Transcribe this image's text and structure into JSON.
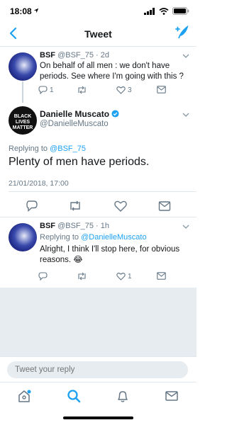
{
  "status_bar": {
    "time": "18:08"
  },
  "nav": {
    "title": "Tweet"
  },
  "tweet_parent": {
    "name": "BSF",
    "handle": "@BSF_75",
    "time": "· 2d",
    "text": "On behalf of all men : we don't have periods. See where I'm going with this ?",
    "reply_count": "1",
    "like_count": "3"
  },
  "tweet_main": {
    "name": "Danielle Muscato",
    "handle": "@DanielleMuscato",
    "avatar_text": [
      "BLACK",
      "LIVES",
      "MATTER"
    ],
    "replying_prefix": "Replying to ",
    "replying_handle": "@BSF_75",
    "text": "Plenty of men have periods.",
    "timestamp": "21/01/2018, 17:00"
  },
  "tweet_reply": {
    "name": "BSF",
    "handle": "@BSF_75",
    "time": "· 1h",
    "replying_prefix": "Replying to ",
    "replying_handle": "@DanielleMuscato",
    "text": "Alright, I think I'll stop here, for obvious reasons. 😂",
    "like_count": "1"
  },
  "compose": {
    "placeholder": "Tweet your reply"
  },
  "colors": {
    "accent": "#1da1f2",
    "secondary_text": "#657786",
    "divider": "#e1e8ed",
    "background_gray": "#e6ecf0"
  },
  "icons": {
    "nav": [
      "back-chevron-icon",
      "compose-tweet-icon"
    ],
    "actions": [
      "reply-icon",
      "retweet-icon",
      "like-icon",
      "direct-message-icon"
    ],
    "tabs": [
      "home-icon",
      "search-icon",
      "notifications-icon",
      "messages-icon"
    ]
  }
}
